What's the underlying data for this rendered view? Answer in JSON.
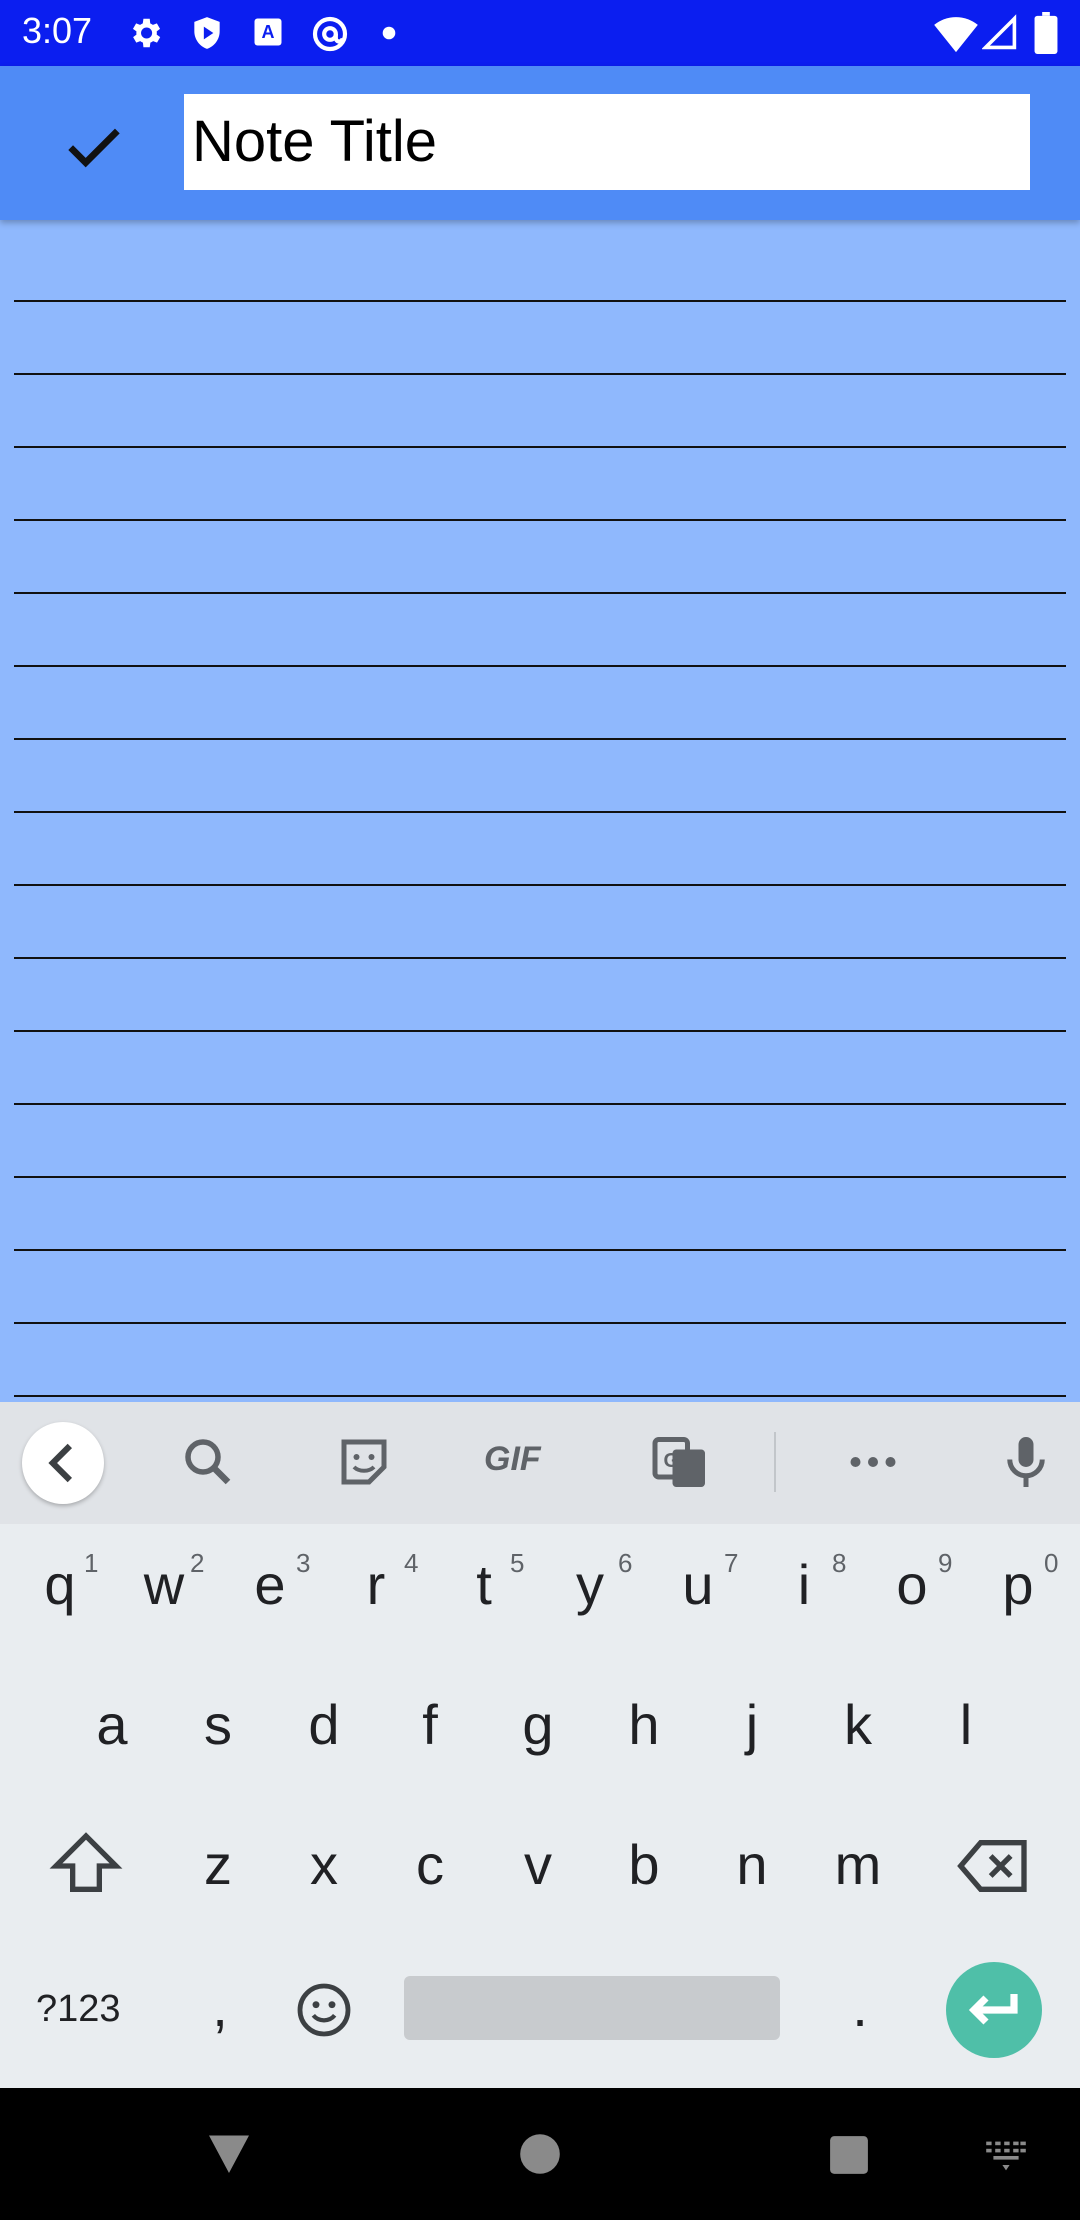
{
  "status_bar": {
    "time": "3:07",
    "left_icons": [
      "settings-icon",
      "shield-play-icon",
      "font-a-icon",
      "at-sign-icon",
      "dot-icon"
    ],
    "right_icons": [
      "wifi-icon",
      "signal-icon",
      "battery-icon"
    ],
    "background": "#0b1ef0"
  },
  "toolbar": {
    "confirm_icon": "check-icon",
    "title_value": "Note Title",
    "background": "#4f8bf6"
  },
  "note_body": {
    "background": "#8fb8fd",
    "line_count": 15
  },
  "keyboard": {
    "toolbar_icons": [
      "back-chevron-icon",
      "search-icon",
      "sticker-icon",
      "gif-icon",
      "translate-icon",
      "more-icon",
      "mic-icon"
    ],
    "gif_label": "GIF",
    "row1": [
      "q",
      "w",
      "e",
      "r",
      "t",
      "y",
      "u",
      "i",
      "o",
      "p"
    ],
    "row1_hints": [
      "1",
      "2",
      "3",
      "4",
      "5",
      "6",
      "7",
      "8",
      "9",
      "0"
    ],
    "row2": [
      "a",
      "s",
      "d",
      "f",
      "g",
      "h",
      "j",
      "k",
      "l"
    ],
    "row3": [
      "z",
      "x",
      "c",
      "v",
      "b",
      "n",
      "m"
    ],
    "symbols_label": "?123",
    "comma": ",",
    "period": ".",
    "enter_color": "#4fbfa8"
  },
  "nav_bar": {
    "icons": [
      "back-triangle-icon",
      "home-circle-icon",
      "recents-square-icon",
      "keyboard-switch-icon"
    ]
  }
}
